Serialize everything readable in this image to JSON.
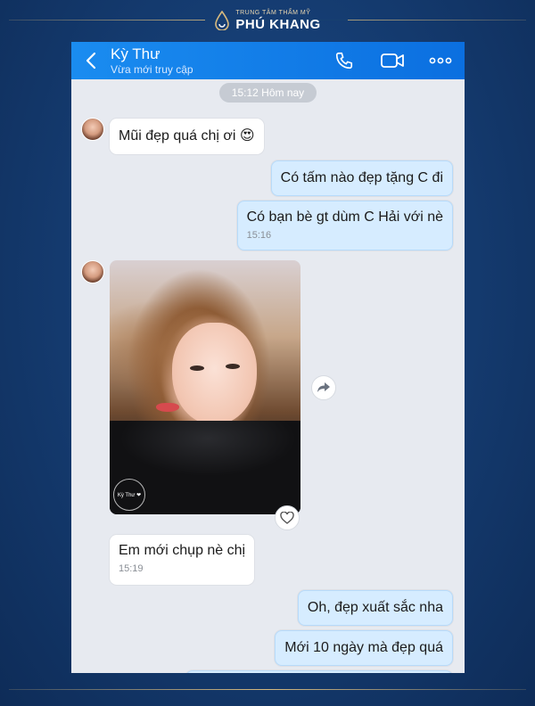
{
  "brand": {
    "tagline": "TRUNG TÂM THẨM MỸ",
    "name": "PHÚ KHANG",
    "gold_color": "#d6b97e",
    "bg_color": "#143a6e"
  },
  "chat": {
    "header": {
      "contact_name": "Kỳ Thư",
      "status": "Vừa mới truy cập",
      "accent_color": "#1a8cf0"
    },
    "date_pill": "15:12 Hôm nay",
    "messages": [
      {
        "side": "in",
        "text": "Mũi đẹp quá chị ơi 😍"
      },
      {
        "side": "out",
        "text": "Có tấm nào đẹp tặng C đi"
      },
      {
        "side": "out",
        "text": "Có bạn bè gt dùm C Hải với nè",
        "time": "15:16"
      },
      {
        "side": "in",
        "type": "photo",
        "watermark": "Kỳ Thư ❤"
      },
      {
        "side": "in",
        "text": "Em mới chụp nè chị",
        "time": "15:19"
      },
      {
        "side": "out",
        "text": "Oh, đẹp xuất sắc nha"
      },
      {
        "side": "out",
        "text": "Mới 10 ngày mà đẹp quá"
      }
    ]
  }
}
